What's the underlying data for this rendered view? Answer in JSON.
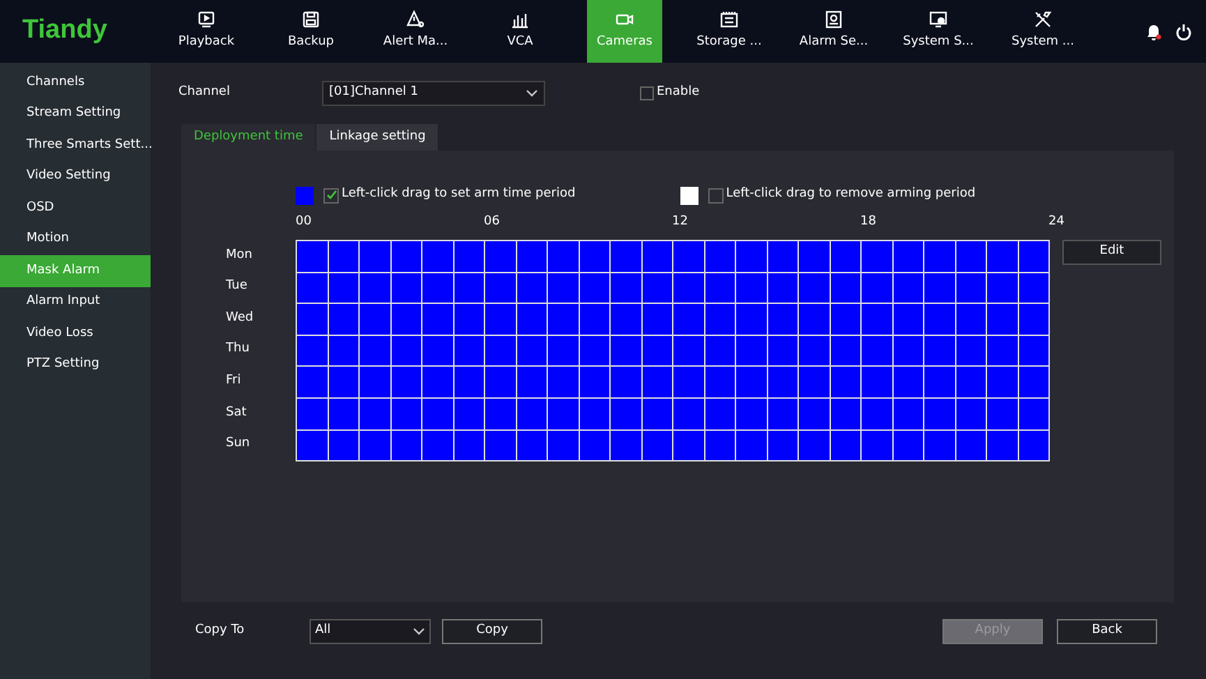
{
  "logo": "Tiandy",
  "nav": [
    {
      "label": "Playback",
      "kind": "play",
      "selected": false
    },
    {
      "label": "Backup",
      "kind": "disk",
      "selected": false
    },
    {
      "label": "Alert Ma...",
      "kind": "alert",
      "selected": false
    },
    {
      "label": "VCA",
      "kind": "bars",
      "selected": false
    },
    {
      "label": "Cameras",
      "kind": "camera",
      "selected": true
    },
    {
      "label": "Storage ...",
      "kind": "storage",
      "selected": false
    },
    {
      "label": "Alarm Se...",
      "kind": "alarm",
      "selected": false
    },
    {
      "label": "System S...",
      "kind": "monitor",
      "selected": false
    },
    {
      "label": "System ...",
      "kind": "tools",
      "selected": false
    }
  ],
  "sidebar": {
    "items": [
      {
        "label": "Channels",
        "selected": false
      },
      {
        "label": "Stream Setting",
        "selected": false
      },
      {
        "label": "Three Smarts Sett...",
        "selected": false
      },
      {
        "label": "Video Setting",
        "selected": false
      },
      {
        "label": "OSD",
        "selected": false
      },
      {
        "label": "Motion",
        "selected": false
      },
      {
        "label": "Mask Alarm",
        "selected": true
      },
      {
        "label": "Alarm Input",
        "selected": false
      },
      {
        "label": "Video Loss",
        "selected": false
      },
      {
        "label": "PTZ Setting",
        "selected": false
      }
    ]
  },
  "channel": {
    "label": "Channel",
    "value": "[01]Channel 1"
  },
  "enable": {
    "label": "Enable",
    "checked": false
  },
  "tabs": [
    {
      "label": "Deployment time",
      "selected": true
    },
    {
      "label": "Linkage setting",
      "selected": false
    }
  ],
  "legend": [
    {
      "kind": "arm",
      "label": "Left-click drag to set arm time period",
      "checked": true
    },
    {
      "kind": "remove",
      "label": "Left-click drag to remove arming period",
      "checked": false
    }
  ],
  "hour_labels": [
    "00",
    "06",
    "12",
    "18",
    "24"
  ],
  "schedule": [
    {
      "day": "Mon",
      "armed": [
        true,
        true,
        true,
        true,
        true,
        true,
        true,
        true,
        true,
        true,
        true,
        true,
        true,
        true,
        true,
        true,
        true,
        true,
        true,
        true,
        true,
        true,
        true,
        true
      ]
    },
    {
      "day": "Tue",
      "armed": [
        true,
        true,
        true,
        true,
        true,
        true,
        true,
        true,
        true,
        true,
        true,
        true,
        true,
        true,
        true,
        true,
        true,
        true,
        true,
        true,
        true,
        true,
        true,
        true
      ]
    },
    {
      "day": "Wed",
      "armed": [
        true,
        true,
        true,
        true,
        true,
        true,
        true,
        true,
        true,
        true,
        true,
        true,
        true,
        true,
        true,
        true,
        true,
        true,
        true,
        true,
        true,
        true,
        true,
        true
      ]
    },
    {
      "day": "Thu",
      "armed": [
        true,
        true,
        true,
        true,
        true,
        true,
        true,
        true,
        true,
        true,
        true,
        true,
        true,
        true,
        true,
        true,
        true,
        true,
        true,
        true,
        true,
        true,
        true,
        true
      ]
    },
    {
      "day": "Fri",
      "armed": [
        true,
        true,
        true,
        true,
        true,
        true,
        true,
        true,
        true,
        true,
        true,
        true,
        true,
        true,
        true,
        true,
        true,
        true,
        true,
        true,
        true,
        true,
        true,
        true
      ]
    },
    {
      "day": "Sat",
      "armed": [
        true,
        true,
        true,
        true,
        true,
        true,
        true,
        true,
        true,
        true,
        true,
        true,
        true,
        true,
        true,
        true,
        true,
        true,
        true,
        true,
        true,
        true,
        true,
        true
      ]
    },
    {
      "day": "Sun",
      "armed": [
        true,
        true,
        true,
        true,
        true,
        true,
        true,
        true,
        true,
        true,
        true,
        true,
        true,
        true,
        true,
        true,
        true,
        true,
        true,
        true,
        true,
        true,
        true,
        true
      ]
    }
  ],
  "edit_button": "Edit",
  "copy_to": {
    "label": "Copy To",
    "value": "All",
    "button": "Copy"
  },
  "buttons": [
    {
      "label": "Apply",
      "disabled": true
    },
    {
      "label": "Back",
      "disabled": false
    }
  ]
}
